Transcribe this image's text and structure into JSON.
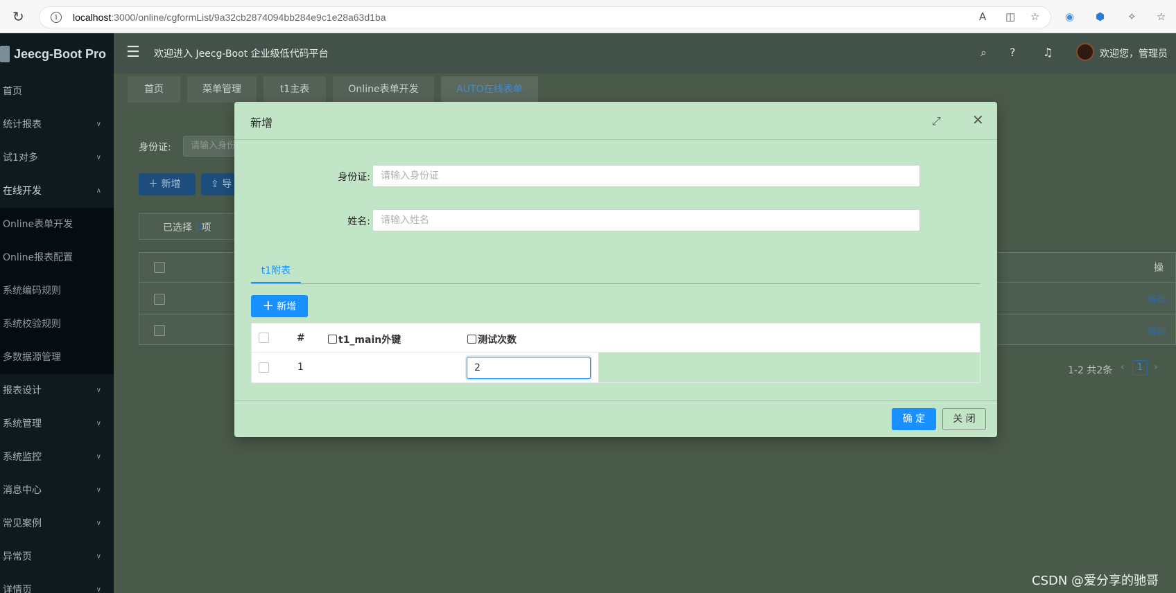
{
  "browser": {
    "url_host": "localhost",
    "url_path": ":3000/online/cgformList/9a32cb2874094bb284e9c1e28a63d1ba"
  },
  "app": {
    "logo_text": "Jeecg-Boot Pro",
    "welcome": "欢迎进入 Jeecg-Boot 企业级低代码平台",
    "user_greeting": "欢迎您，管理员"
  },
  "sidebar": {
    "items": [
      {
        "label": "首页"
      },
      {
        "label": "统计报表"
      },
      {
        "label": "试1对多"
      },
      {
        "label": "在线开发"
      },
      {
        "label": "Online表单开发"
      },
      {
        "label": "Online报表配置"
      },
      {
        "label": "系统编码规则"
      },
      {
        "label": "系统校验规则"
      },
      {
        "label": "多数据源管理"
      },
      {
        "label": "报表设计"
      },
      {
        "label": "系统管理"
      },
      {
        "label": "系统监控"
      },
      {
        "label": "消息中心"
      },
      {
        "label": "常见案例"
      },
      {
        "label": "异常页"
      },
      {
        "label": "详情页"
      }
    ]
  },
  "tabs": [
    {
      "label": "首页"
    },
    {
      "label": "菜单管理"
    },
    {
      "label": "t1主表"
    },
    {
      "label": "Online表单开发"
    },
    {
      "label": "AUTO在线表单"
    }
  ],
  "background": {
    "search_label": "身份证:",
    "search_placeholder": "请输入身份",
    "add_label": "新增",
    "import_label": "导",
    "selected_prefix": "已选择",
    "selected_count": "0",
    "selected_suffix": "项",
    "edit_link": "编辑",
    "pager_total": "1-2 共2条",
    "page_current": "1",
    "col_partial": "操"
  },
  "modal": {
    "title": "新增",
    "fields": [
      {
        "label": "身份证:",
        "placeholder": "请输入身份证"
      },
      {
        "label": "姓名:",
        "placeholder": "请输入姓名"
      }
    ],
    "subtab": "t1附表",
    "add_button": "新增",
    "grid": {
      "headers": [
        "#",
        "t1_main外键",
        "测试次数"
      ],
      "rows": [
        {
          "index": "1",
          "fk": "",
          "count": "2"
        }
      ]
    },
    "ok_button": "确 定",
    "close_button": "关 闭"
  },
  "watermark": "CSDN @爱分享的驰哥"
}
